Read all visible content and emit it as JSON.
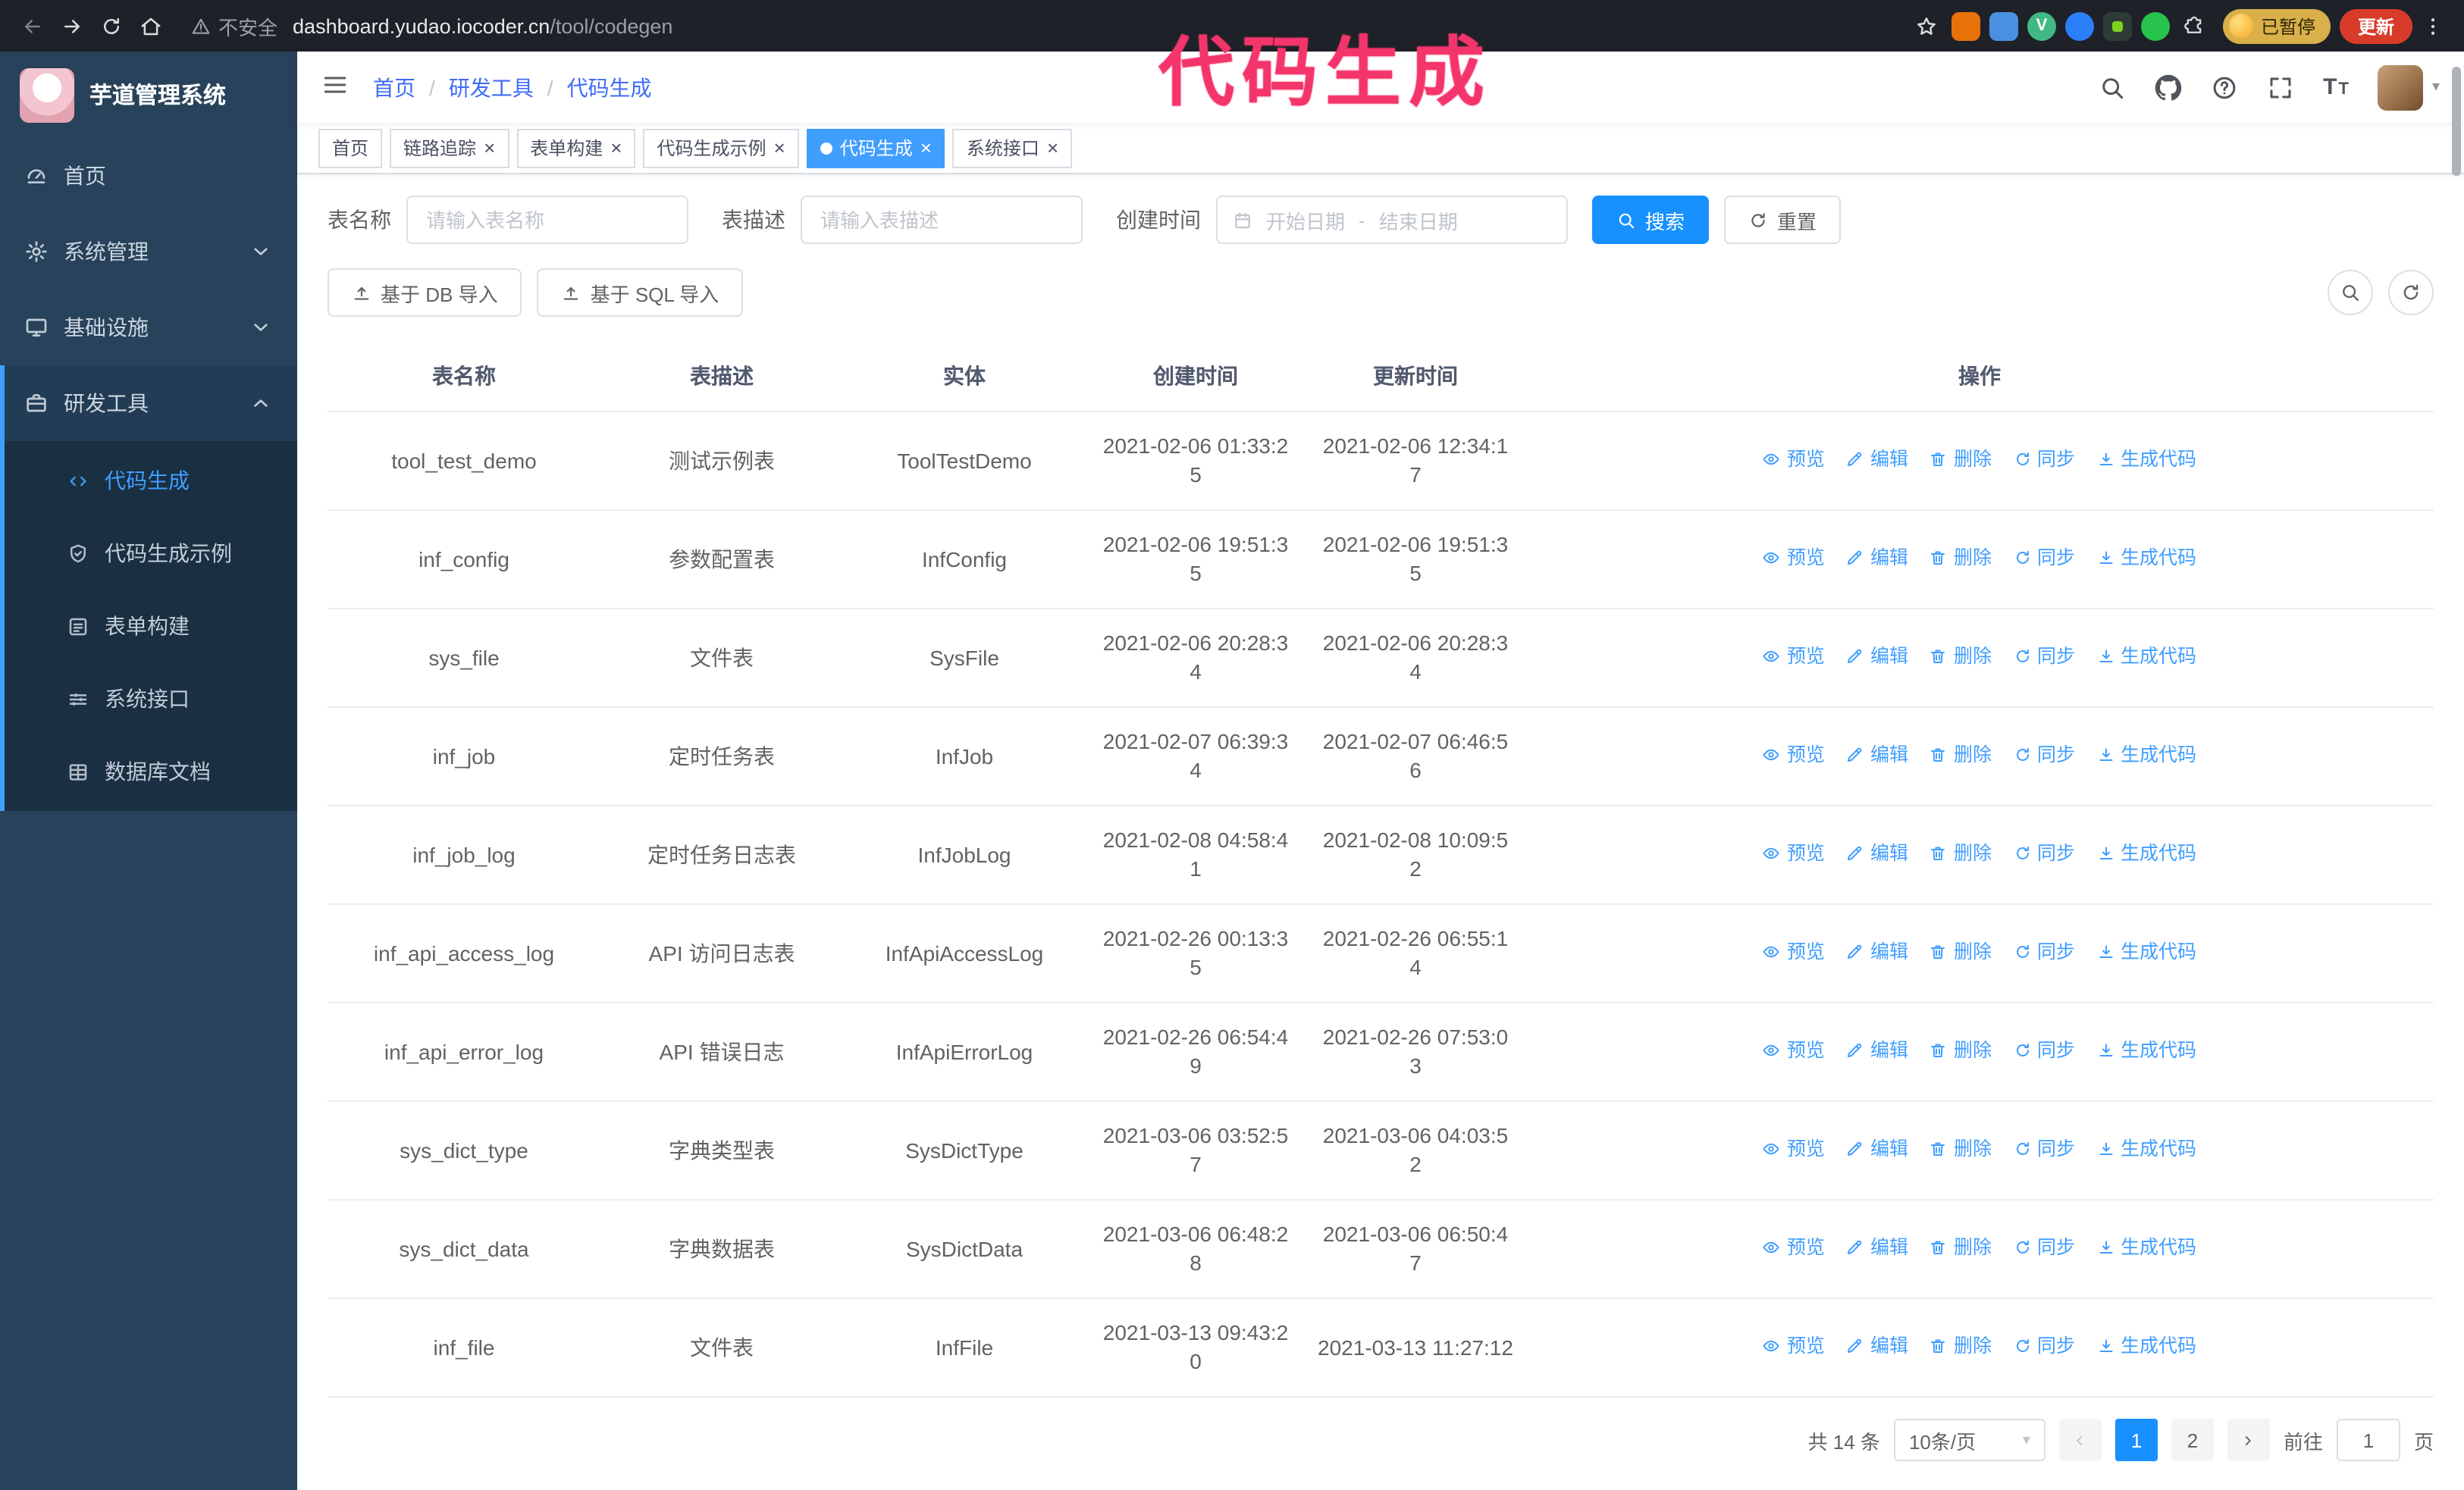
{
  "colors": {
    "accent_blue": "#1890ff",
    "link_blue": "#409eff",
    "sidebar_bg": "#27425a",
    "annotation_pink": "#f4356b",
    "update_button_red": "#d93b2b"
  },
  "annotation": {
    "text": "代码生成"
  },
  "browser": {
    "security_label": "不安全",
    "url_domain": "dashboard.yudao.iocoder.cn",
    "url_path": "/tool/codegen",
    "profile_status": "已暂停",
    "update_label": "更新",
    "vue_extension_letter": "V"
  },
  "icons": {
    "close": "×",
    "caret_down": "▾",
    "font_size_text": "T"
  },
  "sidebar": {
    "app_title": "芋道管理系统",
    "items": [
      {
        "label": "首页"
      },
      {
        "label": "系统管理"
      },
      {
        "label": "基础设施"
      },
      {
        "label": "研发工具",
        "expanded": true
      }
    ],
    "children": [
      {
        "label": "代码生成",
        "active": true
      },
      {
        "label": "代码生成示例"
      },
      {
        "label": "表单构建"
      },
      {
        "label": "系统接口"
      },
      {
        "label": "数据库文档"
      }
    ]
  },
  "breadcrumb": [
    "首页",
    "研发工具",
    "代码生成"
  ],
  "breadcrumb_separator": "/",
  "tabs": [
    {
      "label": "首页",
      "closable": false,
      "active": false
    },
    {
      "label": "链路追踪",
      "closable": true,
      "active": false
    },
    {
      "label": "表单构建",
      "closable": true,
      "active": false
    },
    {
      "label": "代码生成示例",
      "closable": true,
      "active": false
    },
    {
      "label": "代码生成",
      "closable": true,
      "active": true
    },
    {
      "label": "系统接口",
      "closable": true,
      "active": false
    }
  ],
  "search_form": {
    "table_name_label": "表名称",
    "table_name_placeholder": "请输入表名称",
    "table_desc_label": "表描述",
    "table_desc_placeholder": "请输入表描述",
    "create_time_label": "创建时间",
    "date_start_placeholder": "开始日期",
    "date_separator": "-",
    "date_end_placeholder": "结束日期",
    "search_label": "搜索",
    "reset_label": "重置"
  },
  "toolbar": {
    "import_db_label": "基于 DB 导入",
    "import_sql_label": "基于 SQL 导入"
  },
  "table": {
    "columns": [
      "表名称",
      "表描述",
      "实体",
      "创建时间",
      "更新时间",
      "操作"
    ],
    "actions": [
      "预览",
      "编辑",
      "删除",
      "同步",
      "生成代码"
    ],
    "rows": [
      {
        "name": "tool_test_demo",
        "desc": "测试示例表",
        "entity": "ToolTestDemo",
        "created": "2021-02-06 01:33:25",
        "updated": "2021-02-06 12:34:17"
      },
      {
        "name": "inf_config",
        "desc": "参数配置表",
        "entity": "InfConfig",
        "created": "2021-02-06 19:51:35",
        "updated": "2021-02-06 19:51:35"
      },
      {
        "name": "sys_file",
        "desc": "文件表",
        "entity": "SysFile",
        "created": "2021-02-06 20:28:34",
        "updated": "2021-02-06 20:28:34"
      },
      {
        "name": "inf_job",
        "desc": "定时任务表",
        "entity": "InfJob",
        "created": "2021-02-07 06:39:34",
        "updated": "2021-02-07 06:46:56"
      },
      {
        "name": "inf_job_log",
        "desc": "定时任务日志表",
        "entity": "InfJobLog",
        "created": "2021-02-08 04:58:41",
        "updated": "2021-02-08 10:09:52"
      },
      {
        "name": "inf_api_access_log",
        "desc": "API 访问日志表",
        "entity": "InfApiAccessLog",
        "created": "2021-02-26 00:13:35",
        "updated": "2021-02-26 06:55:14"
      },
      {
        "name": "inf_api_error_log",
        "desc": "API 错误日志",
        "entity": "InfApiErrorLog",
        "created": "2021-02-26 06:54:49",
        "updated": "2021-02-26 07:53:03"
      },
      {
        "name": "sys_dict_type",
        "desc": "字典类型表",
        "entity": "SysDictType",
        "created": "2021-03-06 03:52:57",
        "updated": "2021-03-06 04:03:52"
      },
      {
        "name": "sys_dict_data",
        "desc": "字典数据表",
        "entity": "SysDictData",
        "created": "2021-03-06 06:48:28",
        "updated": "2021-03-06 06:50:47"
      },
      {
        "name": "inf_file",
        "desc": "文件表",
        "entity": "InfFile",
        "created": "2021-03-13 09:43:20",
        "updated": "2021-03-13 11:27:12"
      }
    ]
  },
  "pagination": {
    "total_label": "共 14 条",
    "page_size_label": "10条/页",
    "pages": [
      "1",
      "2"
    ],
    "active_page": "1",
    "goto_label": "前往",
    "goto_value": "1",
    "page_unit": "页"
  }
}
